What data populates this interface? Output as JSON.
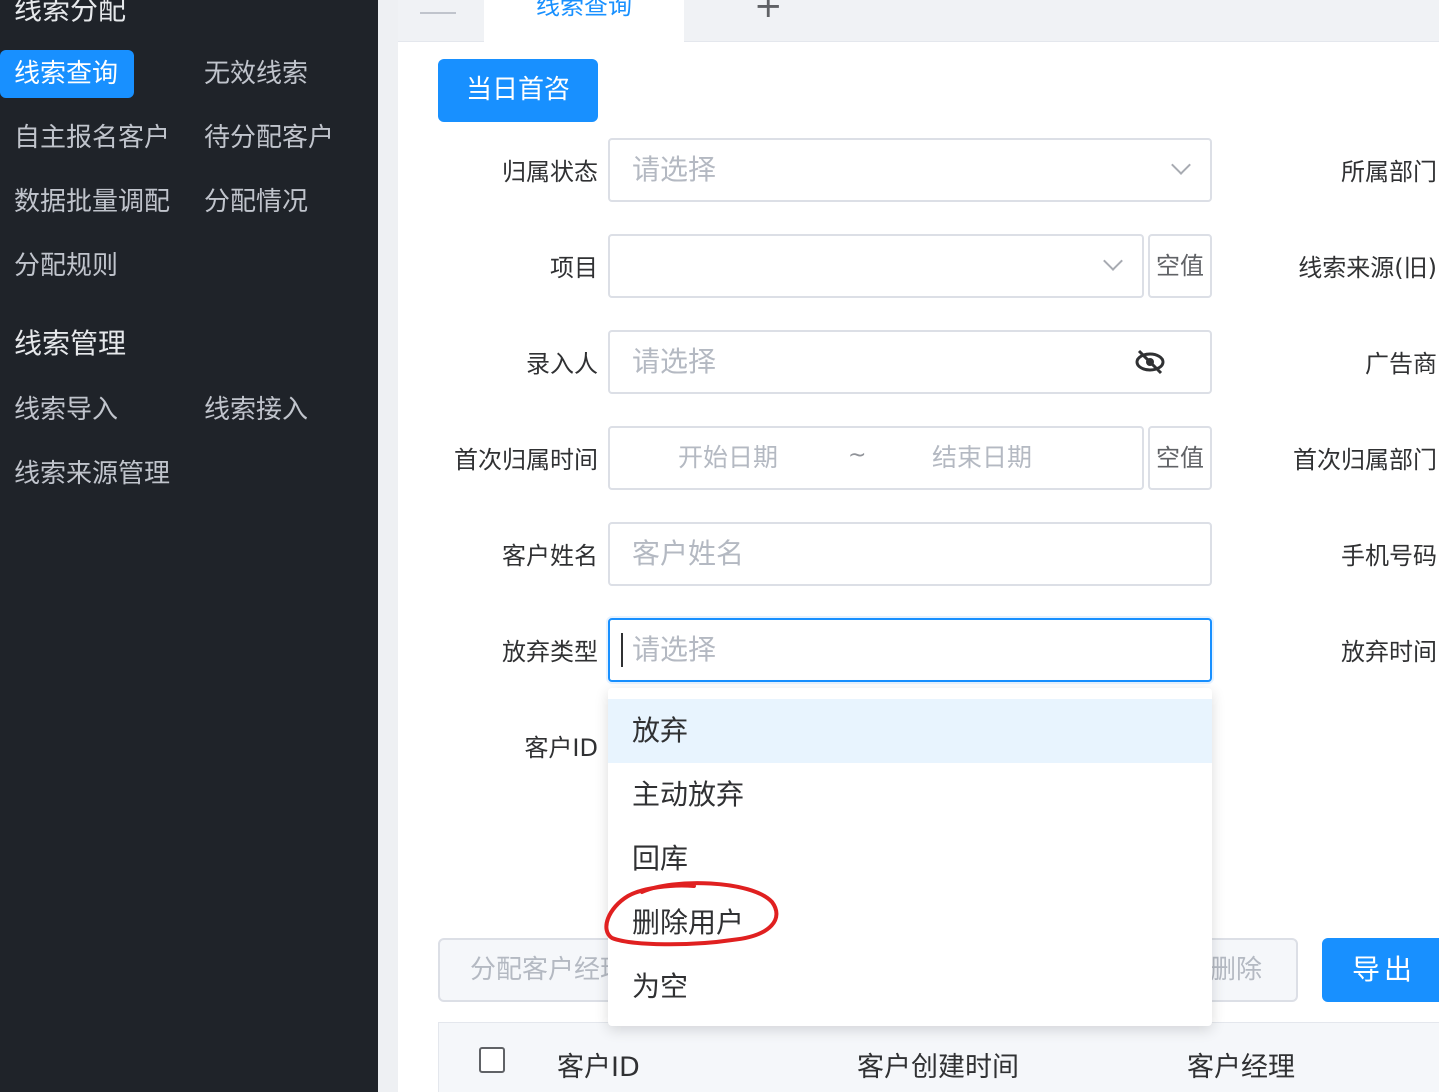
{
  "sidebar": {
    "section1_title": "线索分配",
    "items_row1": [
      "线索查询",
      "无效线索"
    ],
    "items_row2": [
      "自主报名客户",
      "待分配客户"
    ],
    "items_row3": [
      "数据批量调配",
      "分配情况"
    ],
    "items_row4": [
      "分配规则"
    ],
    "section2_title": "线索管理",
    "items_row5": [
      "线索导入",
      "线索接入"
    ],
    "items_row6": [
      "线索来源管理"
    ],
    "active_item": "线索查询"
  },
  "tabs": {
    "active_label": "线索查询",
    "add_label": "+"
  },
  "toolbar": {
    "today_button": "当日首咨"
  },
  "form": {
    "labels": [
      "归属状态",
      "项目",
      "录入人",
      "首次归属时间",
      "客户姓名",
      "放弃类型",
      "客户ID"
    ],
    "right_labels": [
      "所属部门",
      "线索来源(旧)",
      "广告商",
      "首次归属部门",
      "手机号码",
      "放弃时间"
    ],
    "placeholders": {
      "status": "请选择",
      "entry_person": "请选择",
      "start_date": "开始日期",
      "end_date": "结束日期",
      "customer_name": "客户姓名",
      "abandon_type": "请选择"
    },
    "date_separator": "~",
    "null_button": "空值"
  },
  "dropdown": {
    "options": [
      "放弃",
      "主动放弃",
      "回库",
      "删除用户",
      "为空"
    ],
    "highlighted": "放弃",
    "annotated": "删除用户"
  },
  "actions": {
    "assign_button": "分配客户经理",
    "delete_button": "删除",
    "export_button": "导出"
  },
  "table": {
    "columns": [
      "客户ID",
      "客户创建时间",
      "客户经理"
    ]
  },
  "colors": {
    "primary": "#1890ff",
    "sidebar_bg": "#1f2329",
    "annotation": "#e02020"
  }
}
